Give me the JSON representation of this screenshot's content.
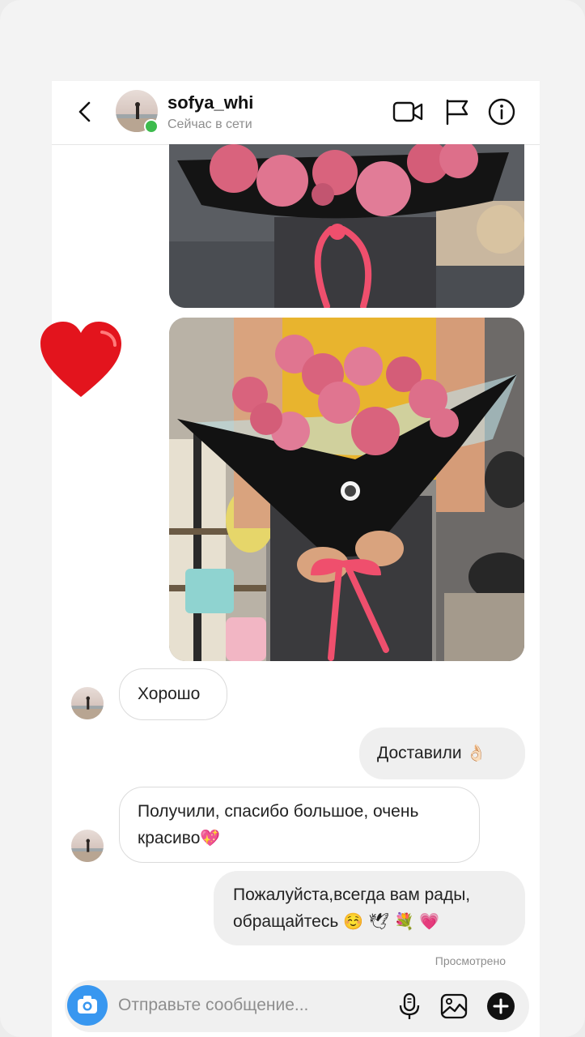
{
  "header": {
    "username": "sofya_whi",
    "status": "Сейчас в сети"
  },
  "icons": {
    "back": "chevron-left-icon",
    "video": "video-camera-icon",
    "report": "flag-icon",
    "info": "info-icon",
    "reaction": "red-heart-icon",
    "camera": "camera-icon",
    "mic": "microphone-icon",
    "gallery": "image-icon",
    "more": "plus-icon"
  },
  "messages": [
    {
      "from": "them",
      "text": "Хорошо"
    },
    {
      "from": "me",
      "text": "Доставили",
      "emoji": "👌🏻"
    },
    {
      "from": "them",
      "line1": "Получили, спасибо большое, очень",
      "line2": "красиво",
      "emoji": "💖"
    },
    {
      "from": "me",
      "line1": "Пожалуйста,всегда вам рады,",
      "line2": "обращайтесь",
      "emoji": "☺️ 🕊 💐 💗"
    }
  ],
  "seen_label": "Просмотрено",
  "composer": {
    "placeholder": "Отправьте сообщение..."
  },
  "colors": {
    "accent": "#3897f0",
    "online": "#3dbb4d",
    "heart": "#e3141d",
    "outgoing_bubble": "#efefef"
  }
}
